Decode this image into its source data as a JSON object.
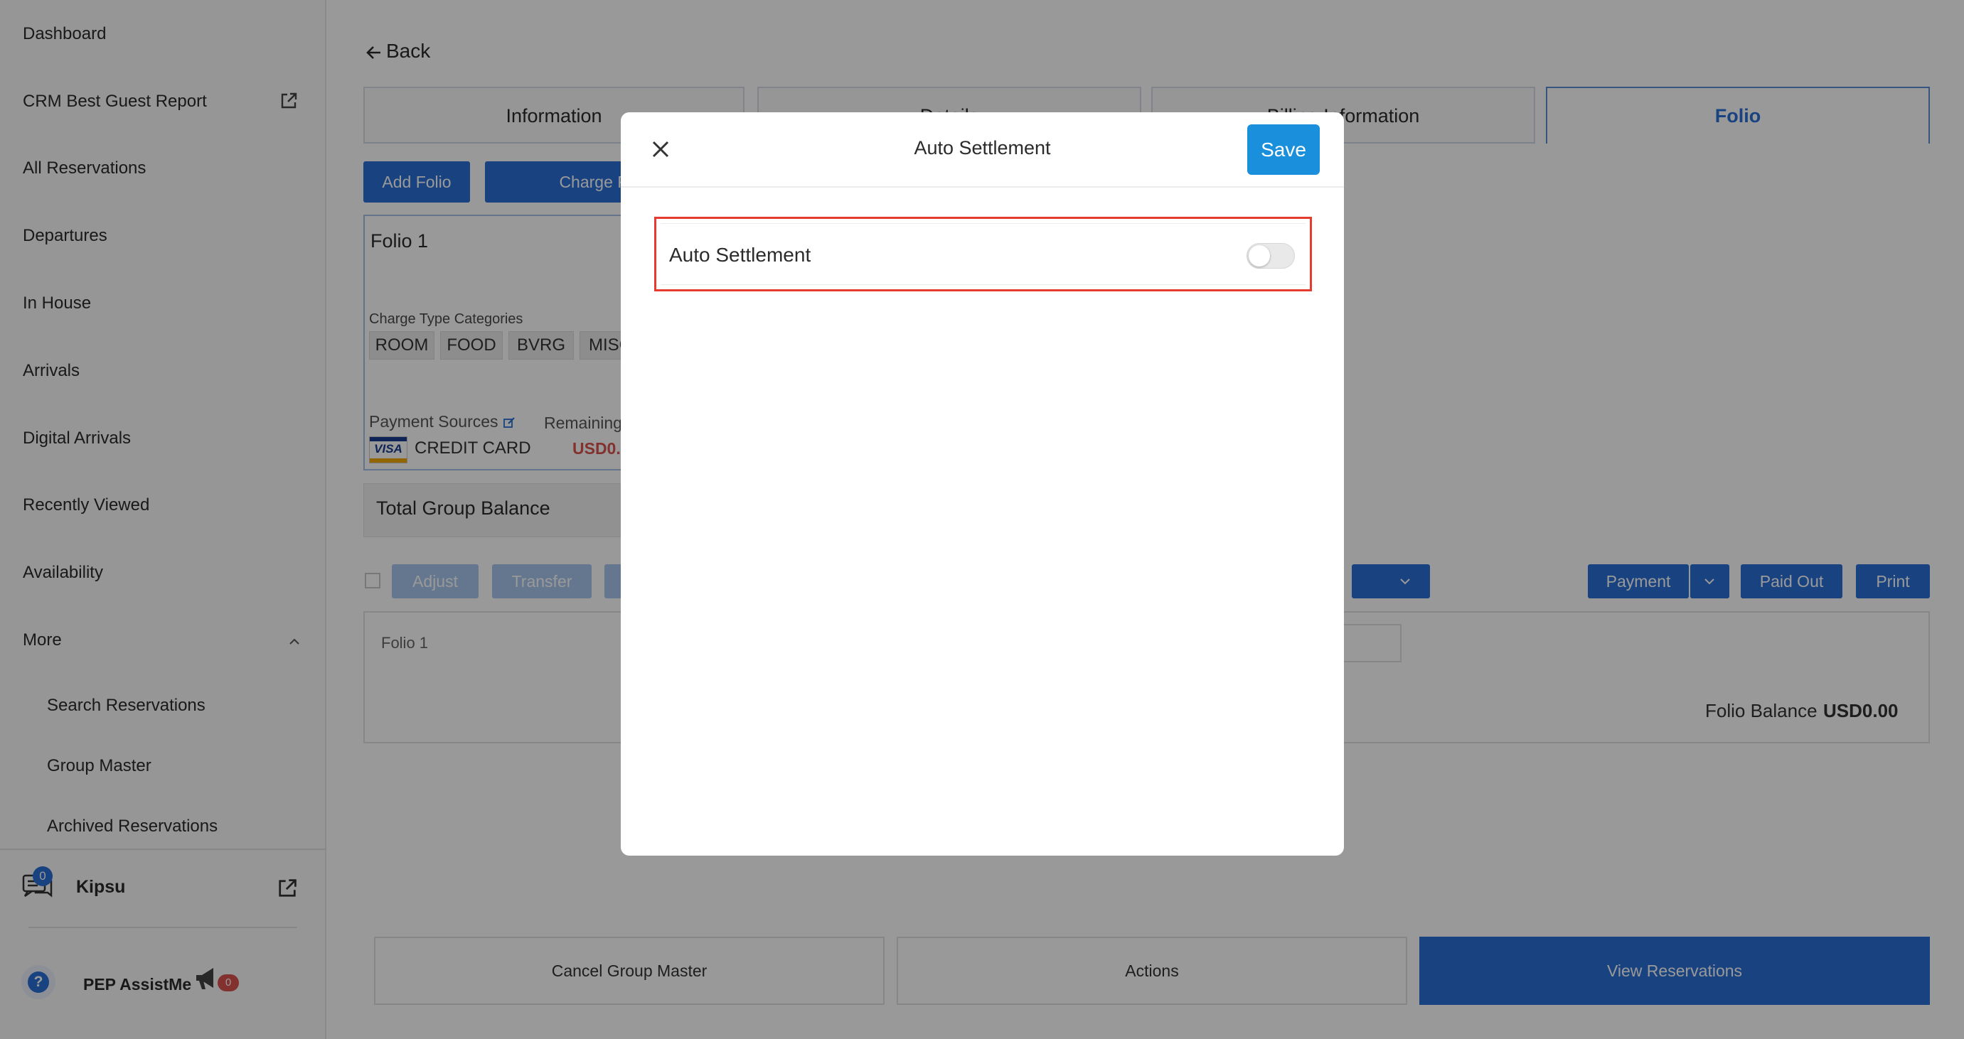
{
  "sidebar": {
    "items": [
      {
        "label": "Dashboard"
      },
      {
        "label": "CRM Best Guest Report"
      },
      {
        "label": "All Reservations"
      },
      {
        "label": "Departures"
      },
      {
        "label": "In House"
      },
      {
        "label": "Arrivals"
      },
      {
        "label": "Digital Arrivals"
      },
      {
        "label": "Recently Viewed"
      },
      {
        "label": "Availability"
      },
      {
        "label": "More"
      }
    ],
    "sub_items": [
      {
        "label": "Search Reservations"
      },
      {
        "label": "Group Master"
      },
      {
        "label": "Archived Reservations"
      }
    ],
    "kipsu": {
      "label": "Kipsu",
      "badge": "0"
    },
    "assist": {
      "label": "PEP AssistMe",
      "badge": "0",
      "help": "?"
    }
  },
  "header": {
    "back_label": "Back"
  },
  "tabs": [
    {
      "label": "Information"
    },
    {
      "label": "Details"
    },
    {
      "label": "Billing Information"
    },
    {
      "label": "Folio"
    }
  ],
  "folio_toolbar": {
    "add_folio": "Add Folio",
    "charge_routing": "Charge Routing"
  },
  "folio_card": {
    "title": "Folio 1",
    "charge_type_label": "Charge Type Categories",
    "categories": [
      "ROOM",
      "FOOD",
      "BVRG",
      "MISC"
    ],
    "payment_sources_label": "Payment Sources",
    "remaining_label": "Remaining",
    "card_brand": "VISA",
    "card_type": "CREDIT CARD",
    "remaining_value": "USD0."
  },
  "group_balance": {
    "label": "Total Group Balance"
  },
  "actions_row": {
    "adjust": "Adjust",
    "transfer": "Transfer",
    "payment": "Payment",
    "paid_out": "Paid Out",
    "print": "Print"
  },
  "folio_panel": {
    "label": "Folio 1",
    "balance_label": "Folio Balance",
    "balance_value": "USD0.00"
  },
  "bottom_buttons": {
    "cancel": "Cancel Group Master",
    "actions": "Actions",
    "view": "View Reservations"
  },
  "modal": {
    "title": "Auto Settlement",
    "save_label": "Save",
    "setting_label": "Auto Settlement",
    "toggle_on": false
  },
  "colors": {
    "accent": "#2a6fd6",
    "save": "#1a8fdc",
    "highlight": "#e63b2e",
    "alert": "#d9534f"
  }
}
